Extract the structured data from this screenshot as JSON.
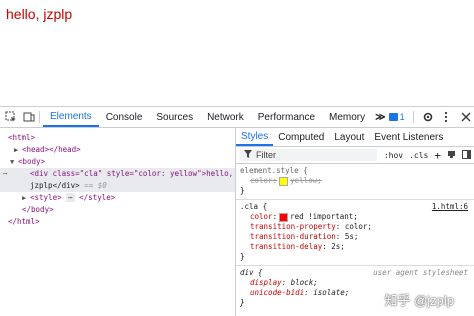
{
  "page": {
    "text": "hello, jzplp"
  },
  "toolbar": {
    "tabs": [
      {
        "label": "Elements",
        "active": true
      },
      {
        "label": "Console"
      },
      {
        "label": "Sources"
      },
      {
        "label": "Network"
      },
      {
        "label": "Performance"
      },
      {
        "label": "Memory"
      }
    ],
    "more": "≫",
    "badge_count": "1",
    "icons": [
      "inspect-icon",
      "device-toggle-icon",
      "message-badge-icon",
      "gear-icon",
      "kebab-menu-icon",
      "close-icon"
    ]
  },
  "dom": {
    "lines": [
      {
        "text": "<html>"
      },
      {
        "text": "<head></head>"
      },
      {
        "text": "<body>"
      },
      {
        "line1": "<div class=\"cla\" style=\"color: yellow\">hello,",
        "line2": "jzplp</div>",
        "eq": " == $0"
      },
      {
        "text": "<style>",
        "ellipsis": "⋯",
        "close": "</style>"
      },
      {
        "text": "</body>"
      },
      {
        "text": "</html>"
      }
    ],
    "dots": "⋯"
  },
  "styles": {
    "tabs": [
      "Styles",
      "Computed",
      "Layout",
      "Event Listeners"
    ],
    "filter": {
      "icon": "filter-icon",
      "placeholder": "Filter",
      "hov": ":hov",
      "cls": ".cls",
      "plus": "+"
    },
    "rules": [
      {
        "selector": "element.style {",
        "props": [
          {
            "name": "color",
            "value": "yellow;",
            "struck": true,
            "swatch": "#ffff00"
          }
        ],
        "close": "}"
      },
      {
        "selector": ".cla {",
        "link": "1.html:6",
        "props": [
          {
            "name": "color",
            "value": "red !important;",
            "swatch": "#ff0000"
          },
          {
            "name": "transition-property",
            "value": "color;"
          },
          {
            "name": "transition-duration",
            "value": "5s;"
          },
          {
            "name": "transition-delay",
            "value": "2s;"
          }
        ],
        "close": "}"
      },
      {
        "selector": "div {",
        "ua": "user agent stylesheet",
        "props": [
          {
            "name": "display",
            "value": "block;"
          },
          {
            "name": "unicode-bidi",
            "value": "isolate;"
          }
        ],
        "close": "}"
      }
    ]
  },
  "watermark": "知乎 @jzplp"
}
